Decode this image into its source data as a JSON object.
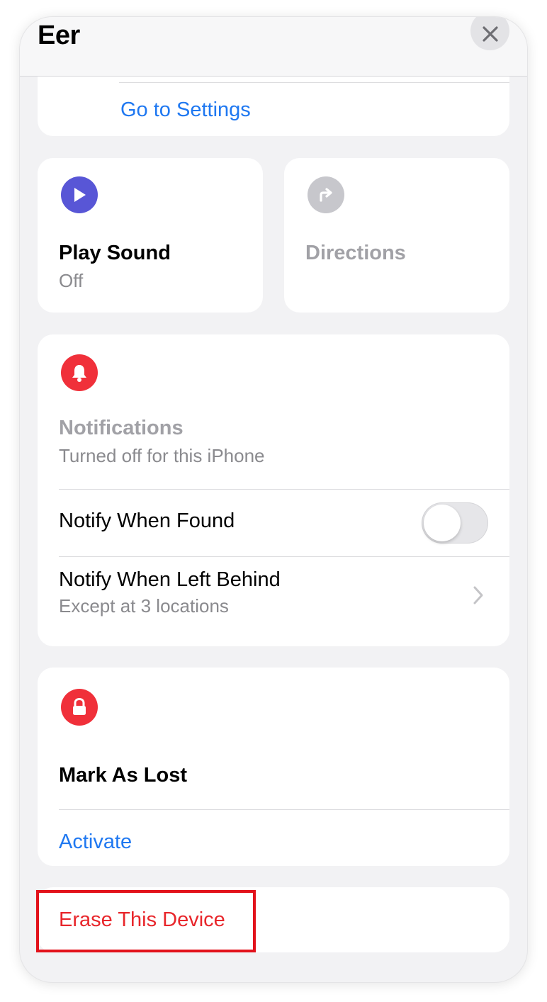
{
  "header": {
    "title": "Eer",
    "close_icon": "close-icon"
  },
  "settings_card": {
    "link_label": "Go to Settings"
  },
  "play_sound": {
    "icon": "play-icon",
    "label": "Play Sound",
    "status": "Off",
    "icon_color": "#5856d6"
  },
  "directions": {
    "icon": "directions-arrow-icon",
    "label": "Directions",
    "icon_color": "#c7c7cc"
  },
  "notifications": {
    "icon": "bell-icon",
    "icon_color": "#f0303a",
    "title": "Notifications",
    "subtitle": "Turned off for this iPhone",
    "notify_when_found": {
      "label": "Notify When Found",
      "enabled": false
    },
    "notify_left_behind": {
      "label": "Notify When Left Behind",
      "detail": "Except at 3 locations"
    }
  },
  "mark_as_lost": {
    "icon": "lock-icon",
    "icon_color": "#f0303a",
    "title": "Mark As Lost",
    "action_label": "Activate"
  },
  "erase": {
    "label": "Erase This Device",
    "color": "#e8262b",
    "highlight_color": "#e2121b"
  }
}
